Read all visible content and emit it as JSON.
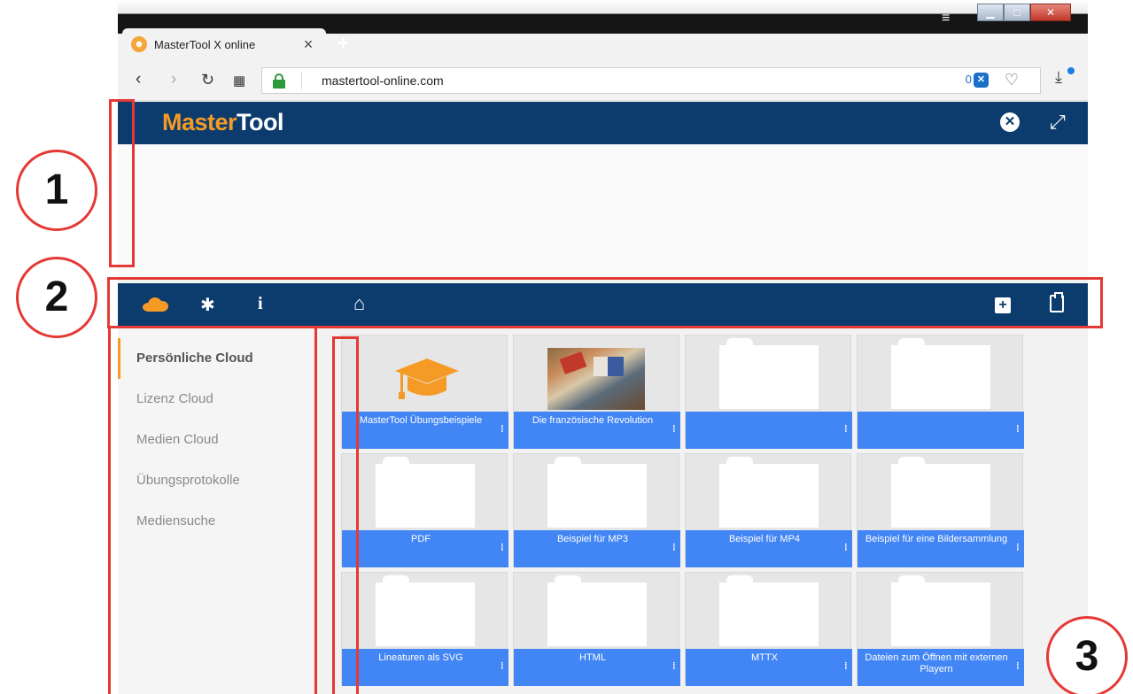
{
  "browser": {
    "tab_title": "MasterTool X online",
    "tab_favicon": "owl-icon",
    "url": "mastertool-online.com",
    "shield_count": "0"
  },
  "app": {
    "logo_part1": "Master",
    "logo_part2": "Tool"
  },
  "sidebar": {
    "items": [
      {
        "label": "Persönliche Cloud",
        "active": true
      },
      {
        "label": "Lizenz Cloud",
        "active": false
      },
      {
        "label": "Medien Cloud",
        "active": false
      },
      {
        "label": "Übungsprotokolle",
        "active": false
      },
      {
        "label": "Mediensuche",
        "active": false
      }
    ]
  },
  "folders": [
    {
      "label": "MasterTool Übungsbeispiele",
      "thumb": "graduation-cap-icon"
    },
    {
      "label": "Die französische Revolution",
      "thumb": "painting"
    },
    {
      "label": "",
      "thumb": "folder"
    },
    {
      "label": "",
      "thumb": "folder"
    },
    {
      "label": "PDF",
      "thumb": "folder"
    },
    {
      "label": "Beispiel für MP3",
      "thumb": "folder"
    },
    {
      "label": "Beispiel für MP4",
      "thumb": "folder"
    },
    {
      "label": "Beispiel für eine Bildersammlung",
      "thumb": "folder"
    },
    {
      "label": "Lineaturen als SVG",
      "thumb": "folder"
    },
    {
      "label": "HTML",
      "thumb": "folder"
    },
    {
      "label": "MTTX",
      "thumb": "folder"
    },
    {
      "label": "Dateien zum Öffnen mit externen Playern",
      "thumb": "folder"
    }
  ],
  "annotations": [
    "1",
    "2",
    "3"
  ],
  "colors": {
    "brand_navy": "#0b3c6d",
    "brand_orange": "#f59b25",
    "caption_blue": "#4285f4",
    "annotation_red": "#e53935"
  }
}
